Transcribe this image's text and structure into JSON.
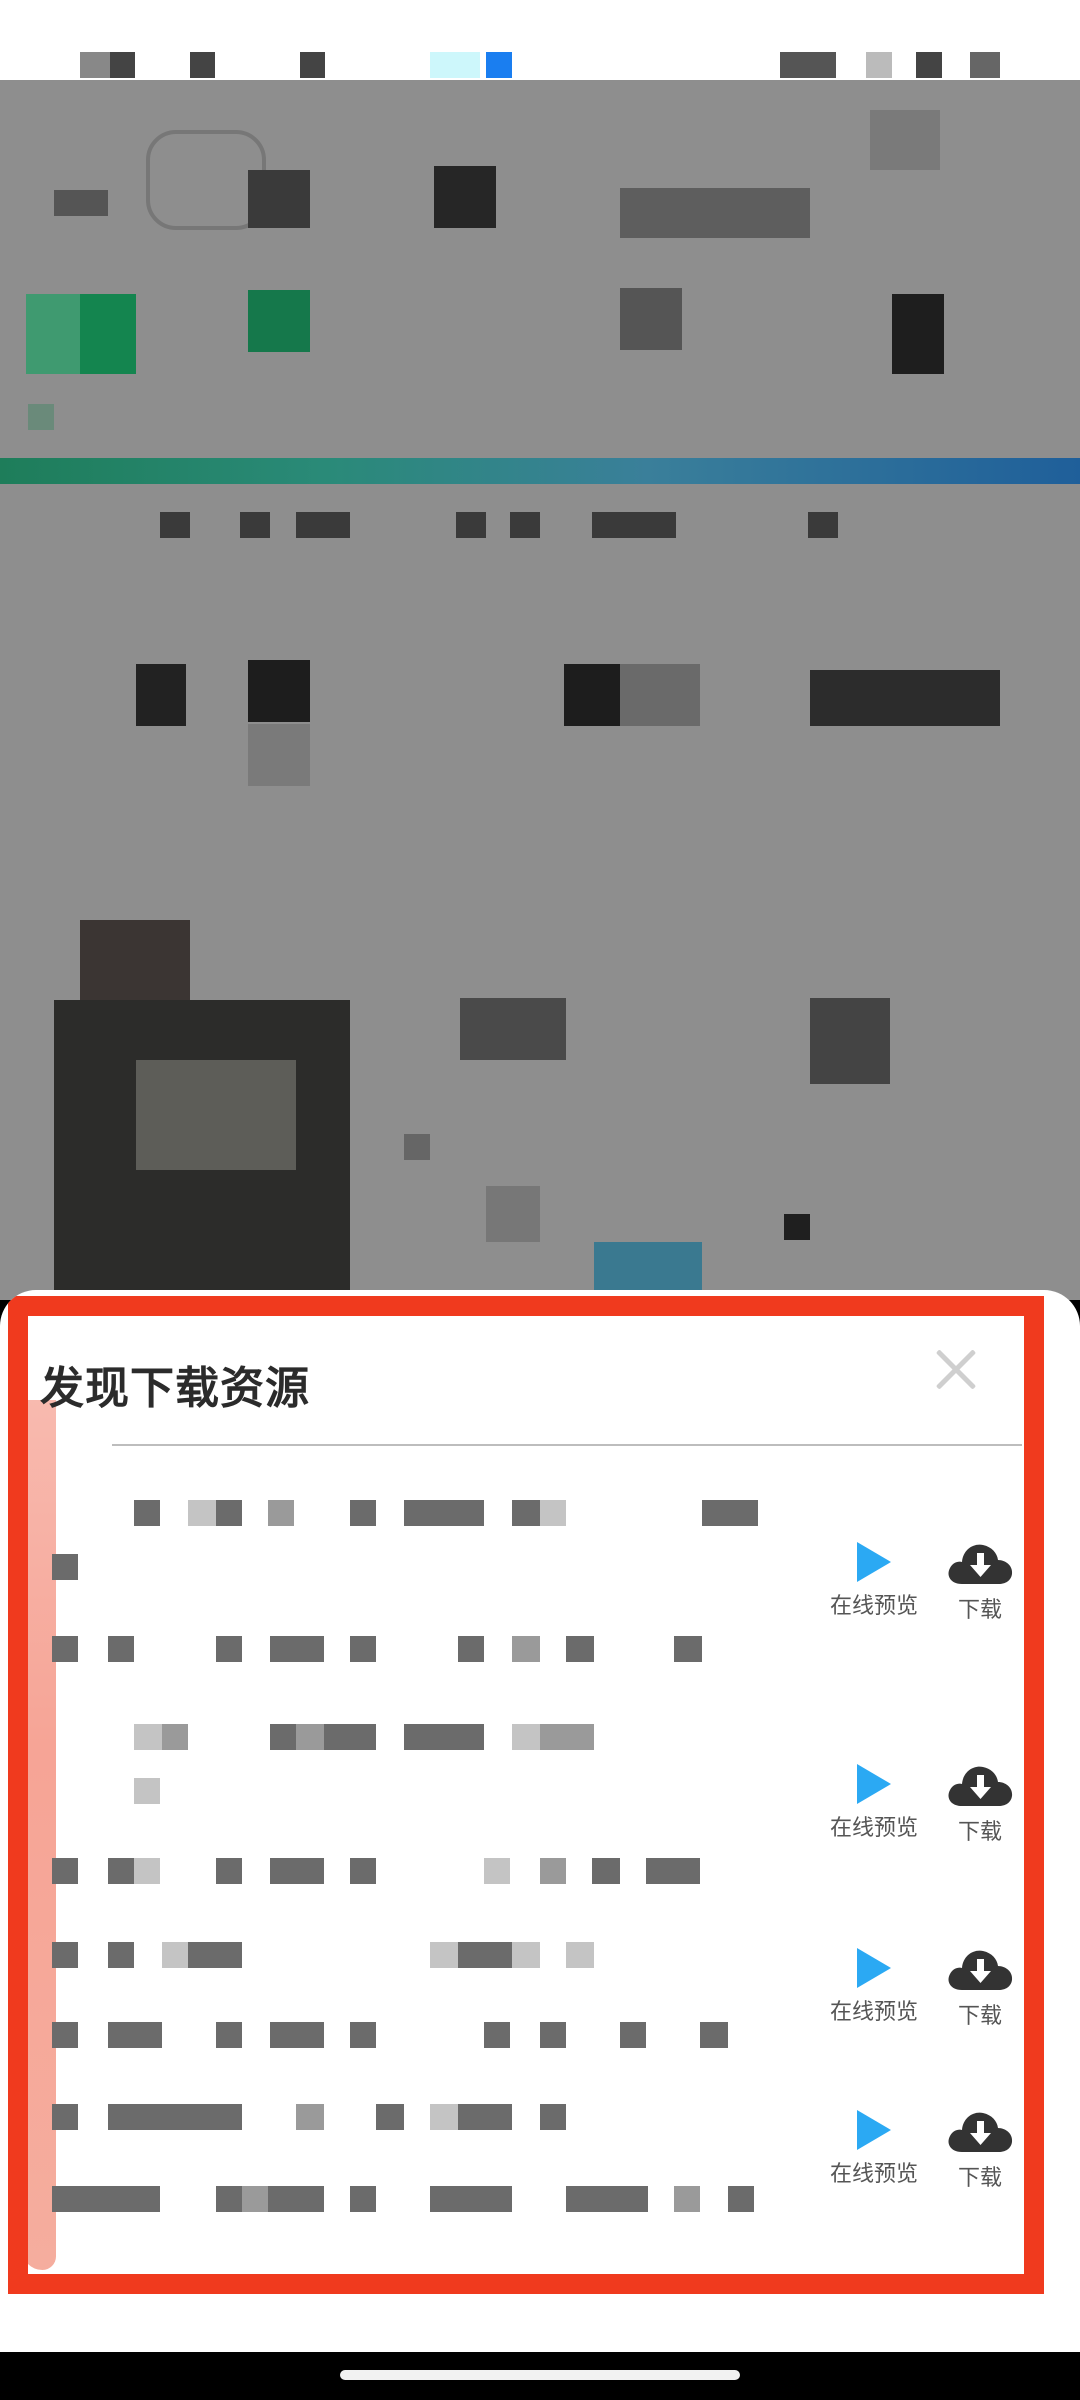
{
  "sheet": {
    "title": "发现下载资源",
    "close_icon": "close-icon",
    "items": [
      {
        "preview_label": "在线预览",
        "download_label": "下载",
        "preview_icon": "play-icon",
        "download_icon": "cloud-download-icon"
      },
      {
        "preview_label": "在线预览",
        "download_label": "下载",
        "preview_icon": "play-icon",
        "download_icon": "cloud-download-icon"
      },
      {
        "preview_label": "在线预览",
        "download_label": "下载",
        "preview_icon": "play-icon",
        "download_icon": "cloud-download-icon"
      },
      {
        "preview_label": "在线预览",
        "download_label": "下载",
        "preview_icon": "play-icon",
        "download_icon": "cloud-download-icon"
      }
    ]
  },
  "colors": {
    "highlight_frame": "#f03a1e",
    "play_icon": "#2ba9f3",
    "download_icon": "#333333",
    "overlay": "#8e8e8e"
  }
}
